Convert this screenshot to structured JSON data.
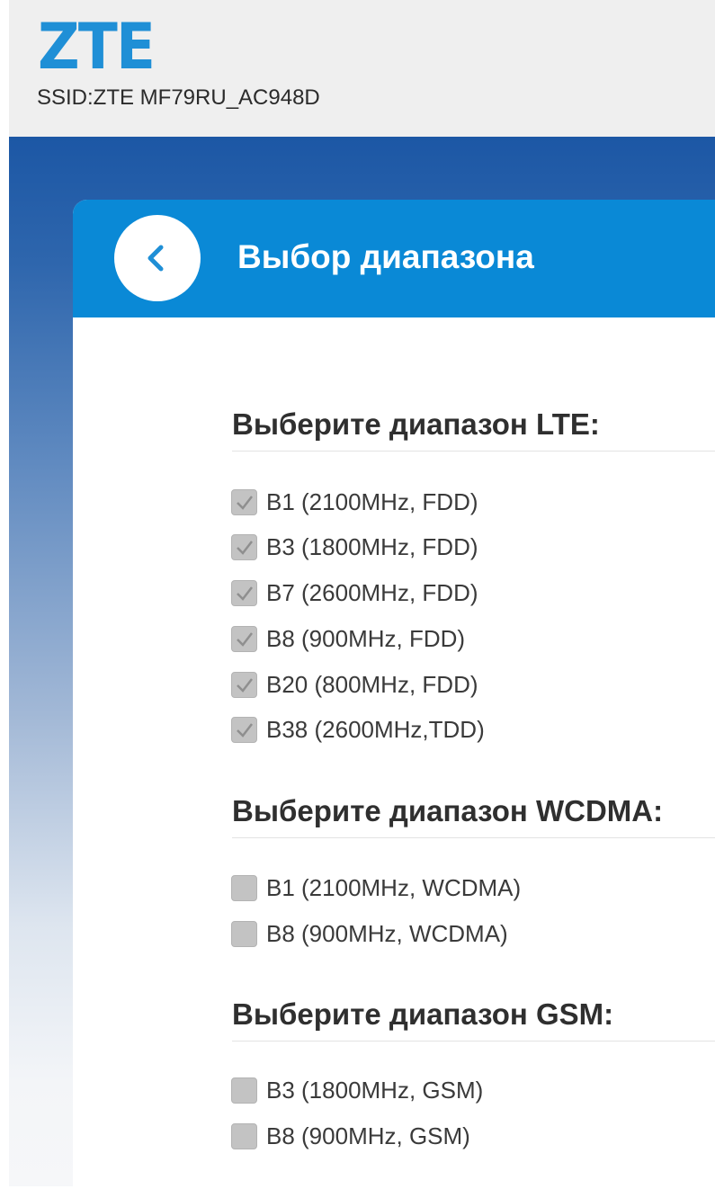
{
  "header": {
    "logo": "ZTE",
    "ssid": "SSID:ZTE MF79RU_AC948D"
  },
  "page": {
    "title": "Выбор диапазона",
    "back_icon": "chevron-left-icon"
  },
  "lte": {
    "title": "Выберите диапазон LTE:",
    "options": [
      {
        "label": "B1 (2100MHz, FDD)",
        "checked": true
      },
      {
        "label": "B3 (1800MHz, FDD)",
        "checked": true
      },
      {
        "label": "B7 (2600MHz, FDD)",
        "checked": true
      },
      {
        "label": "B8 (900MHz, FDD)",
        "checked": true
      },
      {
        "label": "B20 (800MHz, FDD)",
        "checked": true
      },
      {
        "label": "B38 (2600MHz,TDD)",
        "checked": true
      }
    ]
  },
  "wcdma": {
    "title": "Выберите диапазон WCDMA:",
    "options": [
      {
        "label": "B1 (2100MHz, WCDMA)",
        "checked": false
      },
      {
        "label": "B8 (900MHz, WCDMA)",
        "checked": false
      }
    ]
  },
  "gsm": {
    "title": "Выберите диапазон GSM:",
    "options": [
      {
        "label": "B3 (1800MHz, GSM)",
        "checked": false
      },
      {
        "label": "B8 (900MHz, GSM)",
        "checked": false
      }
    ]
  },
  "colors": {
    "brand": "#1f8fd6",
    "header_bar": "#0a89d6",
    "checkbox": "#c3c3c3"
  }
}
